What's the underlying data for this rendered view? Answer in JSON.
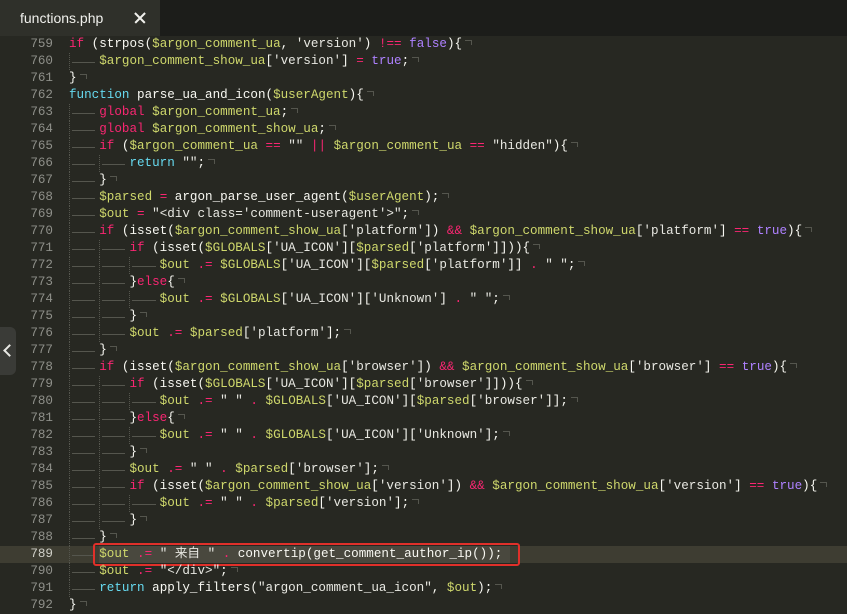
{
  "tabs": [
    {
      "label": "functions.php",
      "active": true,
      "closable": true
    }
  ],
  "icons": {
    "tab_close": "close-icon",
    "panel_toggle": "chevron-left-icon"
  },
  "theme": {
    "background": "#272822",
    "tabbar": "#1c1d1a",
    "tab_active": "#2f302a",
    "tab_text": "#f0f0ec",
    "gutter_fg": "#8f908a",
    "gutter_current": "#d0d0c8",
    "keyword": "#f92672",
    "storage": "#66d9ef",
    "variable": "#cfd86c",
    "string": "#e8e8e2",
    "constant": "#ae81ff",
    "plain": "#f8f8f2",
    "selection": "#49483e",
    "current_line": "#3e3d32",
    "whitespace": "#55564e",
    "annotation": "#e0302a",
    "toggle_bg": "#3a3b37"
  },
  "editor": {
    "current_line": 789,
    "selected_line": 789,
    "annotated_line": 789,
    "lines": [
      {
        "n": 759,
        "tabs": 0,
        "tokens": [
          {
            "kw": "if"
          },
          {
            "p": " (strpos("
          },
          {
            "var": "$argon_comment_ua"
          },
          {
            "p": ", "
          },
          {
            "str": "'version'"
          },
          {
            "p": ") "
          },
          {
            "kw": "!=="
          },
          {
            "p": " "
          },
          {
            "const": "false"
          },
          {
            "p": "){"
          }
        ]
      },
      {
        "n": 760,
        "tabs": 1,
        "tokens": [
          {
            "var": "$argon_comment_show_ua"
          },
          {
            "p": "["
          },
          {
            "str": "'version'"
          },
          {
            "p": "] "
          },
          {
            "kw": "="
          },
          {
            "p": " "
          },
          {
            "const": "true"
          },
          {
            "p": ";"
          }
        ]
      },
      {
        "n": 761,
        "tabs": 0,
        "tokens": [
          {
            "p": "}"
          }
        ]
      },
      {
        "n": 762,
        "tabs": 0,
        "tokens": [
          {
            "st": "function"
          },
          {
            "p": " parse_ua_and_icon("
          },
          {
            "var": "$userAgent"
          },
          {
            "p": "){"
          }
        ]
      },
      {
        "n": 763,
        "tabs": 1,
        "tokens": [
          {
            "kw": "global"
          },
          {
            "p": " "
          },
          {
            "var": "$argon_comment_ua"
          },
          {
            "p": ";"
          }
        ]
      },
      {
        "n": 764,
        "tabs": 1,
        "tokens": [
          {
            "kw": "global"
          },
          {
            "p": " "
          },
          {
            "var": "$argon_comment_show_ua"
          },
          {
            "p": ";"
          }
        ]
      },
      {
        "n": 765,
        "tabs": 1,
        "tokens": [
          {
            "kw": "if"
          },
          {
            "p": " ("
          },
          {
            "var": "$argon_comment_ua"
          },
          {
            "p": " "
          },
          {
            "kw": "=="
          },
          {
            "p": " "
          },
          {
            "str": "\"\""
          },
          {
            "p": " "
          },
          {
            "kw": "||"
          },
          {
            "p": " "
          },
          {
            "var": "$argon_comment_ua"
          },
          {
            "p": " "
          },
          {
            "kw": "=="
          },
          {
            "p": " "
          },
          {
            "str": "\"hidden\""
          },
          {
            "p": "){"
          }
        ]
      },
      {
        "n": 766,
        "tabs": 2,
        "tokens": [
          {
            "st": "return"
          },
          {
            "p": " "
          },
          {
            "str": "\"\""
          },
          {
            "p": ";"
          }
        ]
      },
      {
        "n": 767,
        "tabs": 1,
        "tokens": [
          {
            "p": "}"
          }
        ]
      },
      {
        "n": 768,
        "tabs": 1,
        "tokens": [
          {
            "var": "$parsed"
          },
          {
            "p": " "
          },
          {
            "kw": "="
          },
          {
            "p": " argon_parse_user_agent("
          },
          {
            "var": "$userAgent"
          },
          {
            "p": ");"
          }
        ]
      },
      {
        "n": 769,
        "tabs": 1,
        "tokens": [
          {
            "var": "$out"
          },
          {
            "p": " "
          },
          {
            "kw": "="
          },
          {
            "p": " "
          },
          {
            "str": "\"<div class='comment-useragent'>\""
          },
          {
            "p": ";"
          }
        ]
      },
      {
        "n": 770,
        "tabs": 1,
        "tokens": [
          {
            "kw": "if"
          },
          {
            "p": " (isset("
          },
          {
            "var": "$argon_comment_show_ua"
          },
          {
            "p": "["
          },
          {
            "str": "'platform'"
          },
          {
            "p": "]) "
          },
          {
            "kw": "&&"
          },
          {
            "p": " "
          },
          {
            "var": "$argon_comment_show_ua"
          },
          {
            "p": "["
          },
          {
            "str": "'platform'"
          },
          {
            "p": "] "
          },
          {
            "kw": "=="
          },
          {
            "p": " "
          },
          {
            "const": "true"
          },
          {
            "p": "){"
          }
        ]
      },
      {
        "n": 771,
        "tabs": 2,
        "tokens": [
          {
            "kw": "if"
          },
          {
            "p": " (isset("
          },
          {
            "var": "$GLOBALS"
          },
          {
            "p": "["
          },
          {
            "str": "'UA_ICON'"
          },
          {
            "p": "]["
          },
          {
            "var": "$parsed"
          },
          {
            "p": "["
          },
          {
            "str": "'platform'"
          },
          {
            "p": "]])){"
          }
        ]
      },
      {
        "n": 772,
        "tabs": 3,
        "tokens": [
          {
            "var": "$out"
          },
          {
            "p": " "
          },
          {
            "kw": ".="
          },
          {
            "p": " "
          },
          {
            "var": "$GLOBALS"
          },
          {
            "p": "["
          },
          {
            "str": "'UA_ICON'"
          },
          {
            "p": "]["
          },
          {
            "var": "$parsed"
          },
          {
            "p": "["
          },
          {
            "str": "'platform'"
          },
          {
            "p": "]] "
          },
          {
            "kw": "."
          },
          {
            "p": " "
          },
          {
            "str": "\" \""
          },
          {
            "p": ";"
          }
        ]
      },
      {
        "n": 773,
        "tabs": 2,
        "tokens": [
          {
            "p": "}"
          },
          {
            "kw": "else"
          },
          {
            "p": "{"
          }
        ]
      },
      {
        "n": 774,
        "tabs": 3,
        "tokens": [
          {
            "var": "$out"
          },
          {
            "p": " "
          },
          {
            "kw": ".="
          },
          {
            "p": " "
          },
          {
            "var": "$GLOBALS"
          },
          {
            "p": "["
          },
          {
            "str": "'UA_ICON'"
          },
          {
            "p": "]["
          },
          {
            "str": "'Unknown'"
          },
          {
            "p": "] "
          },
          {
            "kw": "."
          },
          {
            "p": " "
          },
          {
            "str": "\" \""
          },
          {
            "p": ";"
          }
        ]
      },
      {
        "n": 775,
        "tabs": 2,
        "tokens": [
          {
            "p": "}"
          }
        ]
      },
      {
        "n": 776,
        "tabs": 2,
        "tokens": [
          {
            "var": "$out"
          },
          {
            "p": " "
          },
          {
            "kw": ".="
          },
          {
            "p": " "
          },
          {
            "var": "$parsed"
          },
          {
            "p": "["
          },
          {
            "str": "'platform'"
          },
          {
            "p": "];"
          }
        ]
      },
      {
        "n": 777,
        "tabs": 1,
        "tokens": [
          {
            "p": "}"
          }
        ]
      },
      {
        "n": 778,
        "tabs": 1,
        "tokens": [
          {
            "kw": "if"
          },
          {
            "p": " (isset("
          },
          {
            "var": "$argon_comment_show_ua"
          },
          {
            "p": "["
          },
          {
            "str": "'browser'"
          },
          {
            "p": "]) "
          },
          {
            "kw": "&&"
          },
          {
            "p": " "
          },
          {
            "var": "$argon_comment_show_ua"
          },
          {
            "p": "["
          },
          {
            "str": "'browser'"
          },
          {
            "p": "] "
          },
          {
            "kw": "=="
          },
          {
            "p": " "
          },
          {
            "const": "true"
          },
          {
            "p": "){"
          }
        ]
      },
      {
        "n": 779,
        "tabs": 2,
        "tokens": [
          {
            "kw": "if"
          },
          {
            "p": " (isset("
          },
          {
            "var": "$GLOBALS"
          },
          {
            "p": "["
          },
          {
            "str": "'UA_ICON'"
          },
          {
            "p": "]["
          },
          {
            "var": "$parsed"
          },
          {
            "p": "["
          },
          {
            "str": "'browser'"
          },
          {
            "p": "]])){"
          }
        ]
      },
      {
        "n": 780,
        "tabs": 3,
        "tokens": [
          {
            "var": "$out"
          },
          {
            "p": " "
          },
          {
            "kw": ".="
          },
          {
            "p": " "
          },
          {
            "str": "\" \""
          },
          {
            "p": " "
          },
          {
            "kw": "."
          },
          {
            "p": " "
          },
          {
            "var": "$GLOBALS"
          },
          {
            "p": "["
          },
          {
            "str": "'UA_ICON'"
          },
          {
            "p": "]["
          },
          {
            "var": "$parsed"
          },
          {
            "p": "["
          },
          {
            "str": "'browser'"
          },
          {
            "p": "]];"
          }
        ]
      },
      {
        "n": 781,
        "tabs": 2,
        "tokens": [
          {
            "p": "}"
          },
          {
            "kw": "else"
          },
          {
            "p": "{"
          }
        ]
      },
      {
        "n": 782,
        "tabs": 3,
        "tokens": [
          {
            "var": "$out"
          },
          {
            "p": " "
          },
          {
            "kw": ".="
          },
          {
            "p": " "
          },
          {
            "str": "\" \""
          },
          {
            "p": " "
          },
          {
            "kw": "."
          },
          {
            "p": " "
          },
          {
            "var": "$GLOBALS"
          },
          {
            "p": "["
          },
          {
            "str": "'UA_ICON'"
          },
          {
            "p": "]["
          },
          {
            "str": "'Unknown'"
          },
          {
            "p": "];"
          }
        ]
      },
      {
        "n": 783,
        "tabs": 2,
        "tokens": [
          {
            "p": "}"
          }
        ]
      },
      {
        "n": 784,
        "tabs": 2,
        "tokens": [
          {
            "var": "$out"
          },
          {
            "p": " "
          },
          {
            "kw": ".="
          },
          {
            "p": " "
          },
          {
            "str": "\" \""
          },
          {
            "p": " "
          },
          {
            "kw": "."
          },
          {
            "p": " "
          },
          {
            "var": "$parsed"
          },
          {
            "p": "["
          },
          {
            "str": "'browser'"
          },
          {
            "p": "];"
          }
        ]
      },
      {
        "n": 785,
        "tabs": 2,
        "tokens": [
          {
            "kw": "if"
          },
          {
            "p": " (isset("
          },
          {
            "var": "$argon_comment_show_ua"
          },
          {
            "p": "["
          },
          {
            "str": "'version'"
          },
          {
            "p": "]) "
          },
          {
            "kw": "&&"
          },
          {
            "p": " "
          },
          {
            "var": "$argon_comment_show_ua"
          },
          {
            "p": "["
          },
          {
            "str": "'version'"
          },
          {
            "p": "] "
          },
          {
            "kw": "=="
          },
          {
            "p": " "
          },
          {
            "const": "true"
          },
          {
            "p": "){"
          }
        ]
      },
      {
        "n": 786,
        "tabs": 3,
        "tokens": [
          {
            "var": "$out"
          },
          {
            "p": " "
          },
          {
            "kw": ".="
          },
          {
            "p": " "
          },
          {
            "str": "\" \""
          },
          {
            "p": " "
          },
          {
            "kw": "."
          },
          {
            "p": " "
          },
          {
            "var": "$parsed"
          },
          {
            "p": "["
          },
          {
            "str": "'version'"
          },
          {
            "p": "];"
          }
        ]
      },
      {
        "n": 787,
        "tabs": 2,
        "tokens": [
          {
            "p": "}"
          }
        ]
      },
      {
        "n": 788,
        "tabs": 1,
        "tokens": [
          {
            "p": "}"
          }
        ]
      },
      {
        "n": 789,
        "tabs": 1,
        "tokens": [
          {
            "var": "$out"
          },
          {
            "p": " "
          },
          {
            "kw": ".="
          },
          {
            "p": " "
          },
          {
            "str": "\" 来自 \""
          },
          {
            "p": " "
          },
          {
            "kw": "."
          },
          {
            "p": " convertip(get_comment_author_ip());"
          }
        ]
      },
      {
        "n": 790,
        "tabs": 1,
        "tokens": [
          {
            "var": "$out"
          },
          {
            "p": " "
          },
          {
            "kw": ".="
          },
          {
            "p": " "
          },
          {
            "str": "\"</div>\""
          },
          {
            "p": ";"
          }
        ]
      },
      {
        "n": 791,
        "tabs": 1,
        "tokens": [
          {
            "st": "return"
          },
          {
            "p": " apply_filters("
          },
          {
            "str": "\"argon_comment_ua_icon\""
          },
          {
            "p": ", "
          },
          {
            "var": "$out"
          },
          {
            "p": ");"
          }
        ]
      },
      {
        "n": 792,
        "tabs": 0,
        "tokens": [
          {
            "p": "}"
          }
        ]
      }
    ]
  }
}
